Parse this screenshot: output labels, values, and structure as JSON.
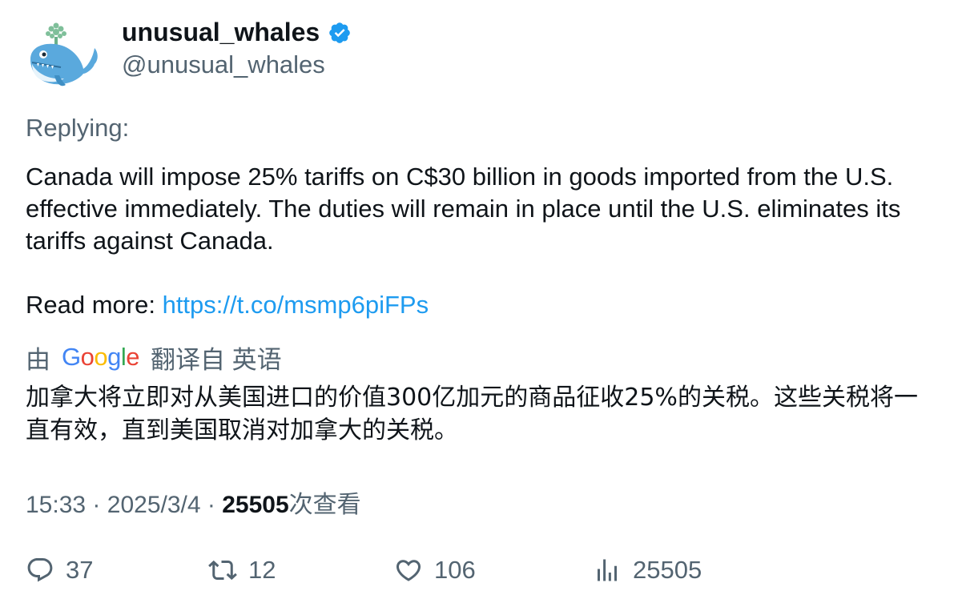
{
  "author": {
    "display_name": "unusual_whales",
    "handle": "@unusual_whales",
    "verified": true,
    "avatar_icon": "whale-icon",
    "verified_color": "#1d9bf0"
  },
  "tweet": {
    "replying_label": "Replying:",
    "text": "Canada will impose 25% tariffs on C$30 billion in goods imported from the U.S. effective immediately. The duties will remain in place until the U.S. eliminates its tariffs against Canada.",
    "read_more_label": "Read more: ",
    "link_text": "https://t.co/msmp6piFPs"
  },
  "translation": {
    "by_label": "由",
    "provider": "Google",
    "from_label": "翻译自 英语",
    "text": "加拿大将立即对从美国进口的价值300亿加元的商品征收25%的关税。这些关税将一直有效，直到美国取消对加拿大的关税。"
  },
  "meta": {
    "time": "15:33",
    "separator": "·",
    "date": "2025/3/4",
    "views_count": "25505",
    "views_label": "次查看"
  },
  "actions": {
    "replies": "37",
    "retweets": "12",
    "likes": "106",
    "views": "25505"
  },
  "colors": {
    "text": "#0f1419",
    "muted": "#536471",
    "link": "#1d9bf0"
  }
}
